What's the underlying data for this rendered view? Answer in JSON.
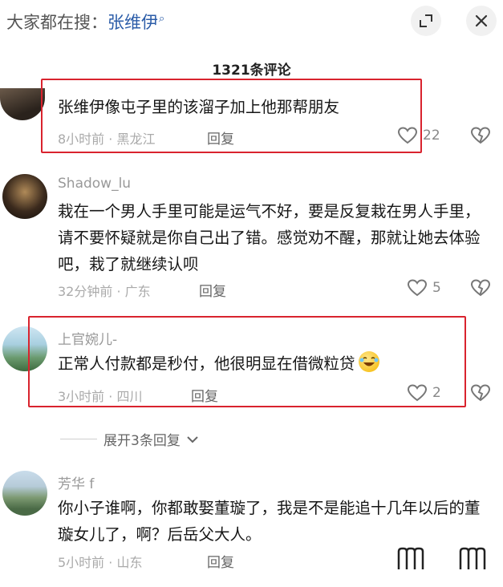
{
  "header": {
    "prefix": "大家都在搜：",
    "term": "张维伊",
    "search_glyph": "⌕",
    "expand_icon": "expand-icon",
    "close_icon": "close-icon"
  },
  "comment_count": "1321条评论",
  "comments": [
    {
      "username": "",
      "text": "张维伊像屯子里的该溜子加上他那帮朋友",
      "meta": "8小时前 · 黑龙江",
      "reply": "回复",
      "likes": "22"
    },
    {
      "username": "Shadow_lu",
      "text": "栽在一个男人手里可能是运气不好，要是反复栽在男人手里，请不要怀疑就是你自己出了错。感觉劝不醒，那就让她去体验吧，栽了就继续认呗",
      "meta": "32分钟前 · 广东",
      "reply": "回复",
      "likes": "5"
    },
    {
      "username": "上官婉儿-",
      "text": "正常人付款都是秒付，他很明显在借微粒贷",
      "meta": "3小时前 · 四川",
      "reply": "回复",
      "likes": "2"
    },
    {
      "username": "芳华 f",
      "text": "你小子谁啊，你都敢娶董璇了，我是不是能追十几年以后的董璇女儿了，啊？后岳父大人。",
      "meta": "5小时前 · 山东",
      "reply": "回复",
      "likes": ""
    }
  ],
  "expand_replies": "展开3条回复",
  "colors": {
    "highlight": "#d9232e",
    "accent": "#2b5ca8"
  }
}
